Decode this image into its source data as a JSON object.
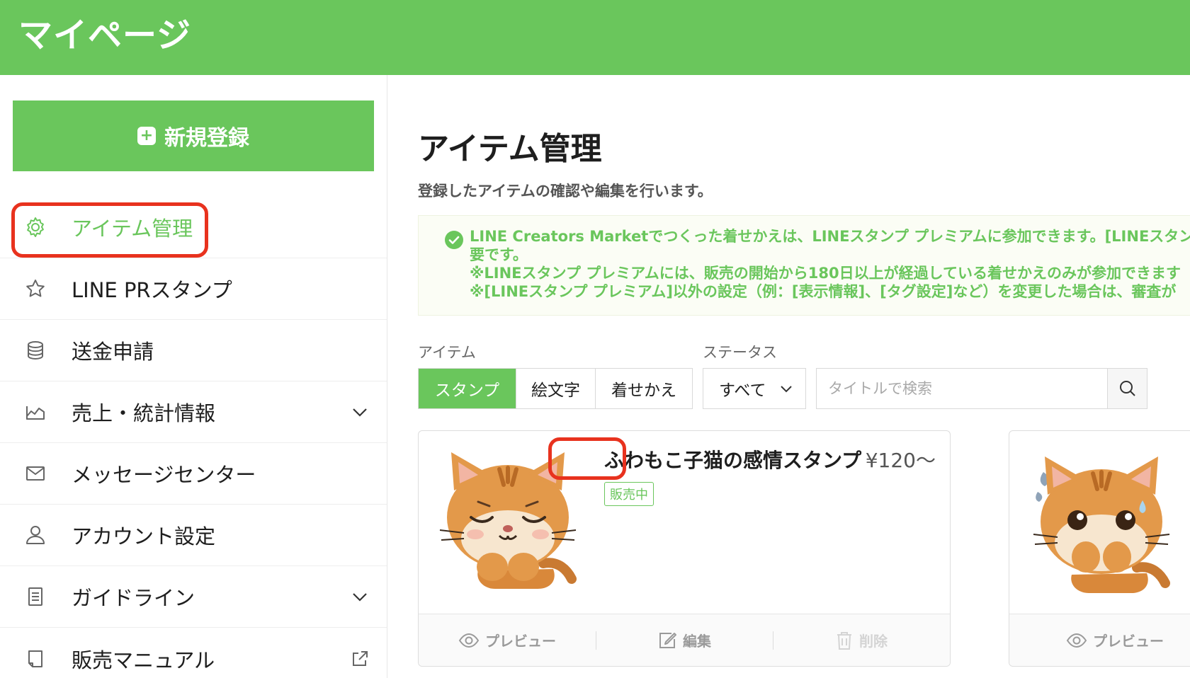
{
  "header": {
    "title": "マイページ"
  },
  "sidebar": {
    "new_button_label": "新規登録",
    "items": [
      {
        "label": "アイテム管理",
        "icon": "gear-icon",
        "active": true
      },
      {
        "label": "LINE PRスタンプ",
        "icon": "star-icon"
      },
      {
        "label": "送金申請",
        "icon": "database-icon"
      },
      {
        "label": "売上・統計情報",
        "icon": "chart-icon",
        "expandable": true
      },
      {
        "label": "メッセージセンター",
        "icon": "mail-icon"
      },
      {
        "label": "アカウント設定",
        "icon": "user-icon"
      },
      {
        "label": "ガイドライン",
        "icon": "document-icon",
        "expandable": true
      },
      {
        "label": "販売マニュアル",
        "icon": "book-icon",
        "external": true
      }
    ]
  },
  "main": {
    "title": "アイテム管理",
    "description": "登録したアイテムの確認や編集を行います。",
    "notice": {
      "lines": [
        "LINE Creators Marketでつくった着せかえは、LINEスタンプ プレミアムに参加できます。[LINEスタン",
        "要です。",
        "※LINEスタンプ プレミアムには、販売の開始から180日以上が経過している着せかえのみが参加できます",
        "※[LINEスタンプ プレミアム]以外の設定（例：[表示情報]、[タグ設定]など）を変更した場合は、審査が"
      ]
    },
    "filters": {
      "item_label": "アイテム",
      "item_options": [
        "スタンプ",
        "絵文字",
        "着せかえ"
      ],
      "item_selected": "スタンプ",
      "status_label": "ステータス",
      "status_value": "すべて",
      "search_placeholder": "タイトルで検索",
      "search_value": ""
    },
    "cards": [
      {
        "title": "ふわもこ子猫の感情スタンプ",
        "price": "¥120〜",
        "status": "販売中",
        "actions": {
          "preview": "プレビュー",
          "edit": "編集",
          "delete": "削除"
        }
      },
      {
        "title": "",
        "price": "",
        "status": "",
        "actions": {
          "preview": "プレビュー"
        }
      }
    ]
  },
  "colors": {
    "brand": "#6ac65c",
    "highlight": "#e8321e",
    "text": "#1e1e1e"
  }
}
